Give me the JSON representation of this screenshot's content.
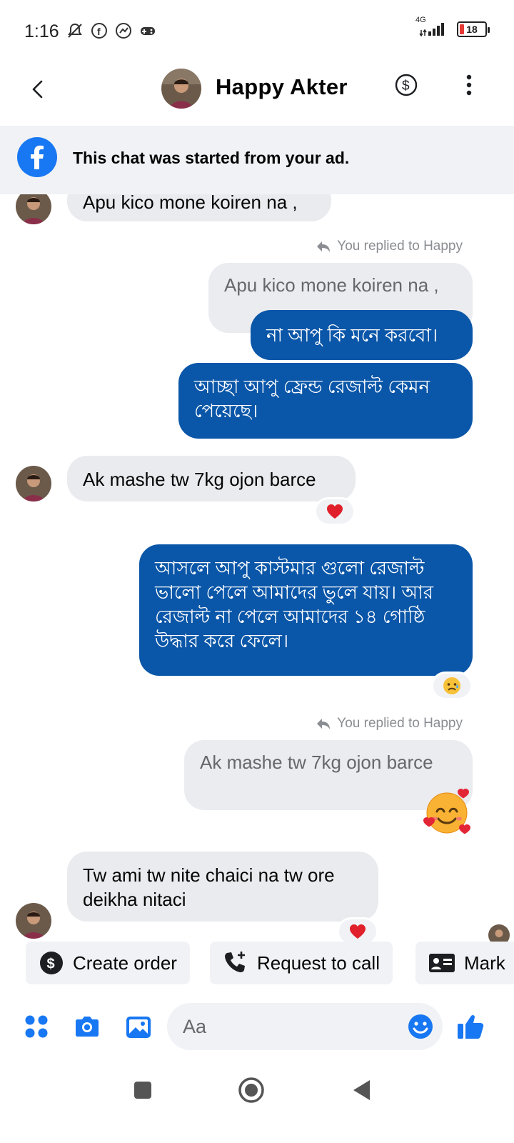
{
  "status": {
    "time": "1:16",
    "network": "4G",
    "battery": "18",
    "battery_fraction": 0.18
  },
  "header": {
    "contact_name": "Happy Akter"
  },
  "banner": {
    "text": "This chat was started from your ad."
  },
  "messages": [
    {
      "text": "Apu kico mone koiren na ,"
    },
    {
      "replied_label": "You replied to Happy"
    },
    {
      "quoted": "Apu kico mone koiren na ,"
    },
    {
      "text": "না আপু কি মনে করবো।"
    },
    {
      "text": "আচ্ছা আপু ফ্রেন্ড রেজাল্ট কেমন পেয়েছে।"
    },
    {
      "text": "Ak mashe tw 7kg ojon barce",
      "reaction": "heart"
    },
    {
      "text": "আসলে আপু কাস্টমার গুলো রেজাল্ট ভালো পেলে আমাদের ভুলে যায়। আর রেজাল্ট না পেলে আমাদের ১৪ গোষ্ঠি উদ্ধার করে ফেলে।",
      "reaction": "sad-face"
    },
    {
      "replied_label": "You replied to Happy"
    },
    {
      "quoted": "Ak mashe tw 7kg ojon barce",
      "reply_emoji": "smiling-face-with-hearts"
    },
    {
      "text": "Tw ami tw nite chaici na tw ore deikha nitaci",
      "reaction": "heart"
    }
  ],
  "quick_actions": [
    {
      "label": "Create order",
      "icon": "dollar-icon"
    },
    {
      "label": "Request to call",
      "icon": "phone-plus-icon"
    },
    {
      "label": "Mark",
      "icon": "id-card-icon"
    }
  ],
  "composer": {
    "placeholder": "Aa"
  },
  "colors": {
    "accent": "#1877f2",
    "outgoing_bubble": "#0a56a8",
    "incoming_bubble": "#e9ebee"
  }
}
